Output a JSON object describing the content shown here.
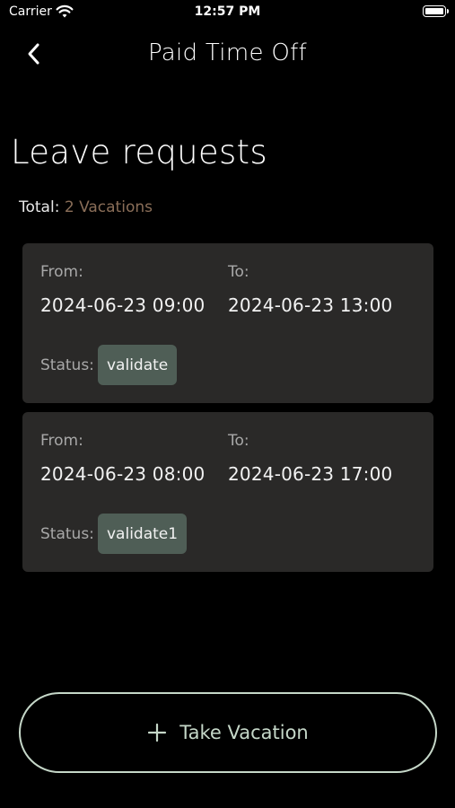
{
  "status_bar": {
    "carrier": "Carrier",
    "time": "12:57 PM",
    "wifi_icon": "wifi-icon",
    "battery_icon": "battery-icon"
  },
  "nav": {
    "back_icon": "chevron-left-icon",
    "title": "Paid Time Off"
  },
  "page": {
    "title": "Leave requests",
    "total_label": "Total:",
    "total_value": "2 Vacations"
  },
  "requests": [
    {
      "from_label": "From:",
      "from_value": "2024-06-23 09:00",
      "to_label": "To:",
      "to_value": "2024-06-23 13:00",
      "status_label": "Status:",
      "status_value": "validate"
    },
    {
      "from_label": "From:",
      "from_value": "2024-06-23 08:00",
      "to_label": "To:",
      "to_value": "2024-06-23 17:00",
      "status_label": "Status:",
      "status_value": "validate1"
    }
  ],
  "actions": {
    "take_vacation_label": "Take Vacation",
    "take_vacation_icon": "plus-icon"
  },
  "colors": {
    "background": "#000000",
    "card_background": "#2a2928",
    "status_badge": "#4f5e56",
    "accent_outline": "#c5d7c8",
    "total_value": "#8a6e58"
  }
}
